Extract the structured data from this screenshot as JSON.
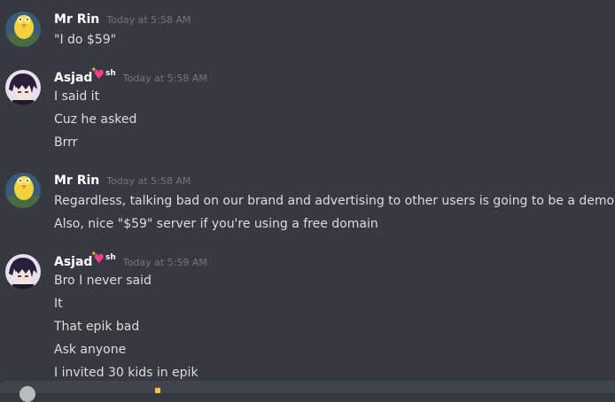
{
  "messages": [
    {
      "username": "Mr Rin",
      "timestamp": "Today at 5:58 AM",
      "avatar": "mr-rin-avatar",
      "lines": [
        "\"I do $59\""
      ]
    },
    {
      "username": "Asjad",
      "name_suffix": "sh",
      "name_emoji": "heart-sparkle",
      "timestamp": "Today at 5:58 AM",
      "avatar": "asjad-avatar",
      "lines": [
        "I said it",
        "Cuz he asked",
        "Brrr"
      ]
    },
    {
      "username": "Mr Rin",
      "timestamp": "Today at 5:58 AM",
      "avatar": "mr-rin-avatar",
      "lines": [
        "Regardless, talking bad on our brand and advertising to other users is going to be a demotion",
        "Also, nice \"$59\" server if you're using a free domain"
      ]
    },
    {
      "username": "Asjad",
      "name_suffix": "sh",
      "name_emoji": "heart-sparkle",
      "timestamp": "Today at 5:59 AM",
      "avatar": "asjad-avatar",
      "lines": [
        "Bro I never said",
        "It",
        "That epik bad",
        "Ask anyone",
        "I invited 30 kids in epik"
      ]
    }
  ],
  "colors": {
    "background": "#36393f",
    "username": "#ffffff",
    "timestamp": "#72767d",
    "message_text": "#dcddde",
    "heart": "#f23f8e"
  }
}
